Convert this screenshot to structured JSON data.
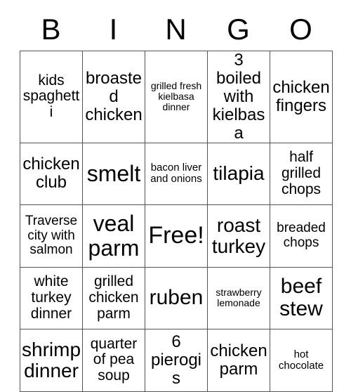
{
  "card": {
    "title": "BINGO",
    "header_letters": [
      "B",
      "I",
      "N",
      "G",
      "O"
    ],
    "grid_rows": 5,
    "grid_cols": 5,
    "border_color": "#555555",
    "background_color": "#ffffff",
    "text_color": "#000000",
    "free_space": {
      "row": 3,
      "col": 3,
      "label": "Free!"
    },
    "cells": [
      [
        {
          "text": "kids spaghetti",
          "size": "xs"
        },
        {
          "text": "broasted chicken",
          "size": "sm"
        },
        {
          "text": "grilled fresh kielbasa dinner",
          "size": "micro"
        },
        {
          "text": "3 boiled with kielbasa",
          "size": "sm"
        },
        {
          "text": "chicken fingers",
          "size": "sm"
        }
      ],
      [
        {
          "text": "chicken club",
          "size": "sm"
        },
        {
          "text": "smelt",
          "size": "lg"
        },
        {
          "text": "bacon liver and onions",
          "size": "tiny"
        },
        {
          "text": "tilapia",
          "size": "md"
        },
        {
          "text": "half grilled chops",
          "size": "xs"
        }
      ],
      [
        {
          "text": "Traverse city with salmon",
          "size": "xxs"
        },
        {
          "text": "veal parm",
          "size": "lg"
        },
        {
          "text": "Free!",
          "size": "xl"
        },
        {
          "text": "roast turkey",
          "size": "md"
        },
        {
          "text": "breaded chops",
          "size": "xxs"
        }
      ],
      [
        {
          "text": "white turkey dinner",
          "size": "xs"
        },
        {
          "text": "grilled chicken parm",
          "size": "xs"
        },
        {
          "text": "ruben",
          "size": "ml"
        },
        {
          "text": "strawberry lemonade",
          "size": "micro"
        },
        {
          "text": "beef stew",
          "size": "ml"
        }
      ],
      [
        {
          "text": "shrimp dinner",
          "size": "md"
        },
        {
          "text": "quarter of pea soup",
          "size": "xs"
        },
        {
          "text": "6 pierogis",
          "size": "sm"
        },
        {
          "text": "chicken parm",
          "size": "sm"
        },
        {
          "text": "hot chocolate",
          "size": "tiny"
        }
      ]
    ]
  }
}
